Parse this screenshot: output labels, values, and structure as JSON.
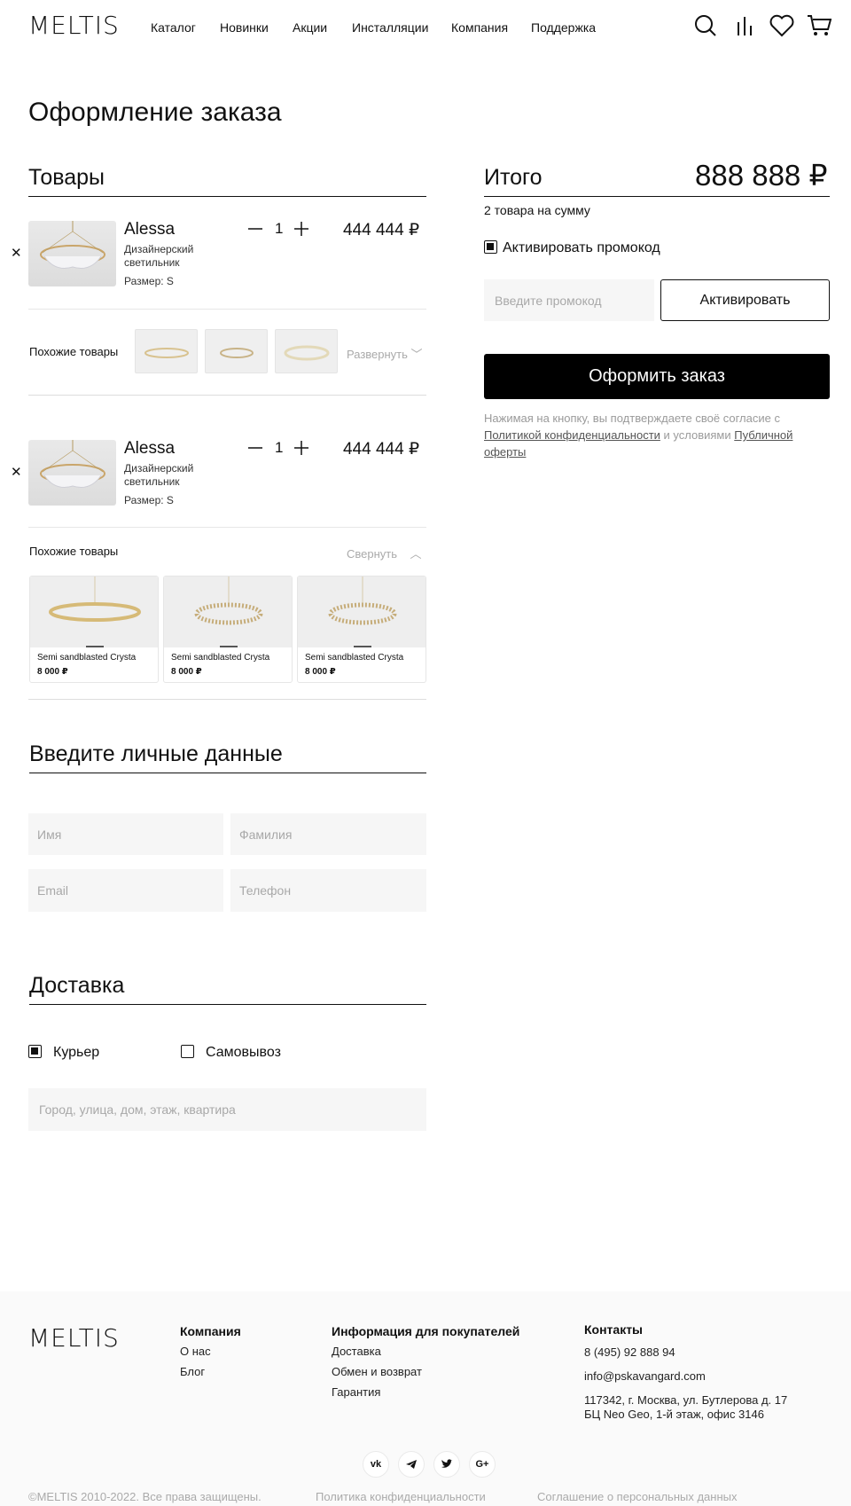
{
  "header": {
    "logo": "MELTIS",
    "nav": [
      "Каталог",
      "Новинки",
      "Акции",
      "Инсталляции",
      "Компания",
      "Поддержка"
    ]
  },
  "page": {
    "title": "Оформление заказа"
  },
  "cart": {
    "title": "Товары",
    "items": [
      {
        "name": "Alessa",
        "desc": "Дизайнерский светильник",
        "size": "Размер: S",
        "qty": "1",
        "price": "444 444 ₽"
      },
      {
        "name": "Alessa",
        "desc": "Дизайнерский светильник",
        "size": "Размер: S",
        "qty": "1",
        "price": "444 444 ₽"
      }
    ],
    "similar_label": "Похожие товары",
    "expand": "Развернуть",
    "collapse": "Свернуть",
    "cards": [
      {
        "name": "Semi sandblasted Crysta",
        "price": "8 000 ₽"
      },
      {
        "name": "Semi sandblasted Crysta",
        "price": "8 000 ₽"
      },
      {
        "name": "Semi sandblasted Crysta",
        "price": "8 000 ₽"
      }
    ]
  },
  "summary": {
    "title": "Итого",
    "total": "888 888 ₽",
    "count_text": "2 товара на сумму",
    "promo_checkbox": "Активировать промокод",
    "promo_placeholder": "Введите промокод",
    "promo_button": "Активировать",
    "checkout_button": "Оформить заказ",
    "legal_1": "Нажимая на кнопку, вы подтверждаете своё согласие с",
    "legal_link1": "Политикой конфиденциальности",
    "legal_2": "и условиями",
    "legal_link2": "Публичной оферты"
  },
  "personal": {
    "title": "Введите личные данные",
    "first_name": "Имя",
    "last_name": "Фамилия",
    "email": "Email",
    "phone": "Телефон"
  },
  "delivery": {
    "title": "Доставка",
    "courier": "Курьер",
    "pickup": "Самовывоз",
    "address_placeholder": "Город, улица, дом, этаж, квартира"
  },
  "footer": {
    "logo": "MELTIS",
    "company_head": "Компания",
    "company_links": [
      "О нас",
      "Блог"
    ],
    "buyers_head": "Информация для покупателей",
    "buyers_links": [
      "Доставка",
      "Обмен и возврат",
      "Гарантия"
    ],
    "contacts_head": "Контакты",
    "phone": "8 (495) 92 888 94",
    "email": "info@pskavangard.com",
    "address_1": "117342, г. Москва, ул. Бутлерова д. 17",
    "address_2": "БЦ Neo Geo, 1-й этаж, офис 3146",
    "social": [
      "vk",
      "tg",
      "tw",
      "G+"
    ],
    "copyright": "©MELTIS 2010-2022. Все права защищены.",
    "privacy": "Политика конфиденциальности",
    "agreement": "Соглашение о персональных данных"
  }
}
